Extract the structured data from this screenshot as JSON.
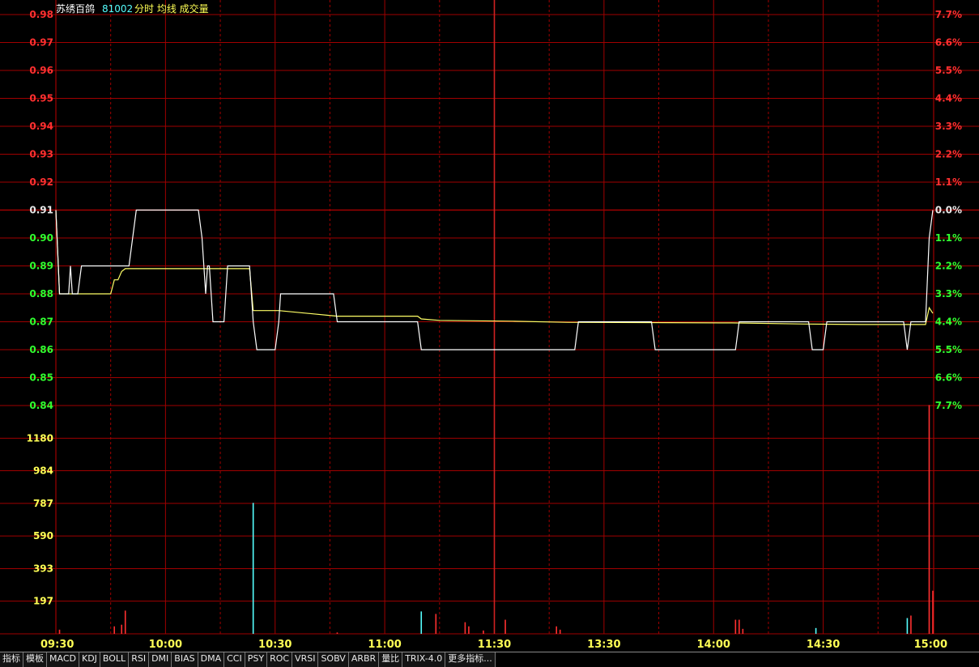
{
  "header": {
    "name": "苏绣百鸽",
    "code": "81002",
    "modes": "分时 均线 成交量"
  },
  "colors": {
    "up": "#ff3030",
    "down": "#30ff30",
    "flat": "#e8e8e8",
    "grid": "#a00000",
    "price_line": "#ffffff",
    "avg_line": "#ffff66",
    "volume_tick": "#ffff55"
  },
  "chart_data": [
    {
      "type": "line",
      "title": "分时",
      "prev_close": 0.91,
      "ylim": [
        0.84,
        0.98
      ],
      "price_ticks": [
        "0.98",
        "0.97",
        "0.96",
        "0.95",
        "0.94",
        "0.93",
        "0.92",
        "0.91",
        "0.90",
        "0.89",
        "0.88",
        "0.87",
        "0.86",
        "0.85",
        "0.84"
      ],
      "pct_ticks": [
        "7.7%",
        "6.6%",
        "5.5%",
        "4.4%",
        "3.3%",
        "2.2%",
        "1.1%",
        "0.0%",
        "1.1%",
        "2.2%",
        "3.3%",
        "4.4%",
        "5.5%",
        "6.6%",
        "7.7%"
      ],
      "x_labels": [
        "09:30",
        "10:00",
        "10:30",
        "11:00",
        "11:30",
        "13:30",
        "14:00",
        "14:30",
        "15:00"
      ],
      "x_minutes": [
        0,
        240
      ],
      "series": [
        {
          "role": "price",
          "points": [
            [
              0,
              0.91
            ],
            [
              1,
              0.88
            ],
            [
              3,
              0.88
            ],
            [
              3.5,
              0.88
            ],
            [
              4,
              0.89
            ],
            [
              4.5,
              0.88
            ],
            [
              6,
              0.88
            ],
            [
              7,
              0.89
            ],
            [
              20,
              0.89
            ],
            [
              21,
              0.9
            ],
            [
              22,
              0.91
            ],
            [
              39,
              0.91
            ],
            [
              40,
              0.9
            ],
            [
              41,
              0.88
            ],
            [
              41.5,
              0.89
            ],
            [
              42,
              0.89
            ],
            [
              43,
              0.87
            ],
            [
              46,
              0.87
            ],
            [
              47,
              0.89
            ],
            [
              53,
              0.89
            ],
            [
              54,
              0.87
            ],
            [
              55,
              0.86
            ],
            [
              60,
              0.86
            ],
            [
              61,
              0.87
            ],
            [
              61.5,
              0.88
            ],
            [
              76,
              0.88
            ],
            [
              77,
              0.87
            ],
            [
              99,
              0.87
            ],
            [
              100,
              0.86
            ],
            [
              142,
              0.86
            ],
            [
              143,
              0.87
            ],
            [
              163,
              0.87
            ],
            [
              164,
              0.86
            ],
            [
              186,
              0.86
            ],
            [
              187,
              0.87
            ],
            [
              206,
              0.87
            ],
            [
              207,
              0.86
            ],
            [
              210,
              0.86
            ],
            [
              211,
              0.87
            ],
            [
              232,
              0.87
            ],
            [
              233,
              0.86
            ],
            [
              234,
              0.87
            ],
            [
              238,
              0.87
            ],
            [
              239,
              0.9
            ],
            [
              240,
              0.91
            ]
          ]
        },
        {
          "role": "average",
          "points": [
            [
              0,
              0.91
            ],
            [
              1,
              0.88
            ],
            [
              3,
              0.88
            ],
            [
              15,
              0.88
            ],
            [
              16,
              0.885
            ],
            [
              17,
              0.885
            ],
            [
              18,
              0.888
            ],
            [
              19,
              0.889
            ],
            [
              21,
              0.889
            ],
            [
              40,
              0.889
            ],
            [
              53,
              0.889
            ],
            [
              54,
              0.874
            ],
            [
              61,
              0.874
            ],
            [
              77,
              0.872
            ],
            [
              99,
              0.872
            ],
            [
              100,
              0.871
            ],
            [
              105,
              0.8705
            ],
            [
              125,
              0.8702
            ],
            [
              140,
              0.8698
            ],
            [
              185,
              0.8696
            ],
            [
              205,
              0.8692
            ],
            [
              220,
              0.869
            ],
            [
              238,
              0.869
            ],
            [
              239,
              0.875
            ],
            [
              240,
              0.873
            ]
          ]
        }
      ]
    },
    {
      "type": "bar",
      "title": "成交量",
      "ylim": [
        0,
        1377
      ],
      "ticks": [
        "1180",
        "984",
        "787",
        "590",
        "393",
        "197"
      ],
      "bars": [
        {
          "t": 1,
          "v": 25,
          "c": "up"
        },
        {
          "t": 16,
          "v": 45,
          "c": "up"
        },
        {
          "t": 18,
          "v": 55,
          "c": "up"
        },
        {
          "t": 19,
          "v": 140,
          "c": "up"
        },
        {
          "t": 54,
          "v": 790,
          "c": "down"
        },
        {
          "t": 77,
          "v": 8,
          "c": "up"
        },
        {
          "t": 100,
          "v": 135,
          "c": "down"
        },
        {
          "t": 104,
          "v": 120,
          "c": "up"
        },
        {
          "t": 112,
          "v": 70,
          "c": "up"
        },
        {
          "t": 113,
          "v": 45,
          "c": "up"
        },
        {
          "t": 117,
          "v": 20,
          "c": "up"
        },
        {
          "t": 123,
          "v": 85,
          "c": "up"
        },
        {
          "t": 137,
          "v": 45,
          "c": "up"
        },
        {
          "t": 138,
          "v": 25,
          "c": "up"
        },
        {
          "t": 186,
          "v": 85,
          "c": "up"
        },
        {
          "t": 187,
          "v": 85,
          "c": "up"
        },
        {
          "t": 188,
          "v": 30,
          "c": "up"
        },
        {
          "t": 208,
          "v": 35,
          "c": "down"
        },
        {
          "t": 233,
          "v": 95,
          "c": "down"
        },
        {
          "t": 234,
          "v": 110,
          "c": "up"
        },
        {
          "t": 239,
          "v": 1380,
          "c": "up"
        },
        {
          "t": 240,
          "v": 260,
          "c": "up"
        }
      ]
    }
  ],
  "tabs": [
    "指标",
    "模板",
    "MACD",
    "KDJ",
    "BOLL",
    "RSI",
    "DMI",
    "BIAS",
    "DMA",
    "CCI",
    "PSY",
    "ROC",
    "VRSI",
    "SOBV",
    "ARBR",
    "量比",
    "TRIX-4.0",
    "更多指标..."
  ]
}
